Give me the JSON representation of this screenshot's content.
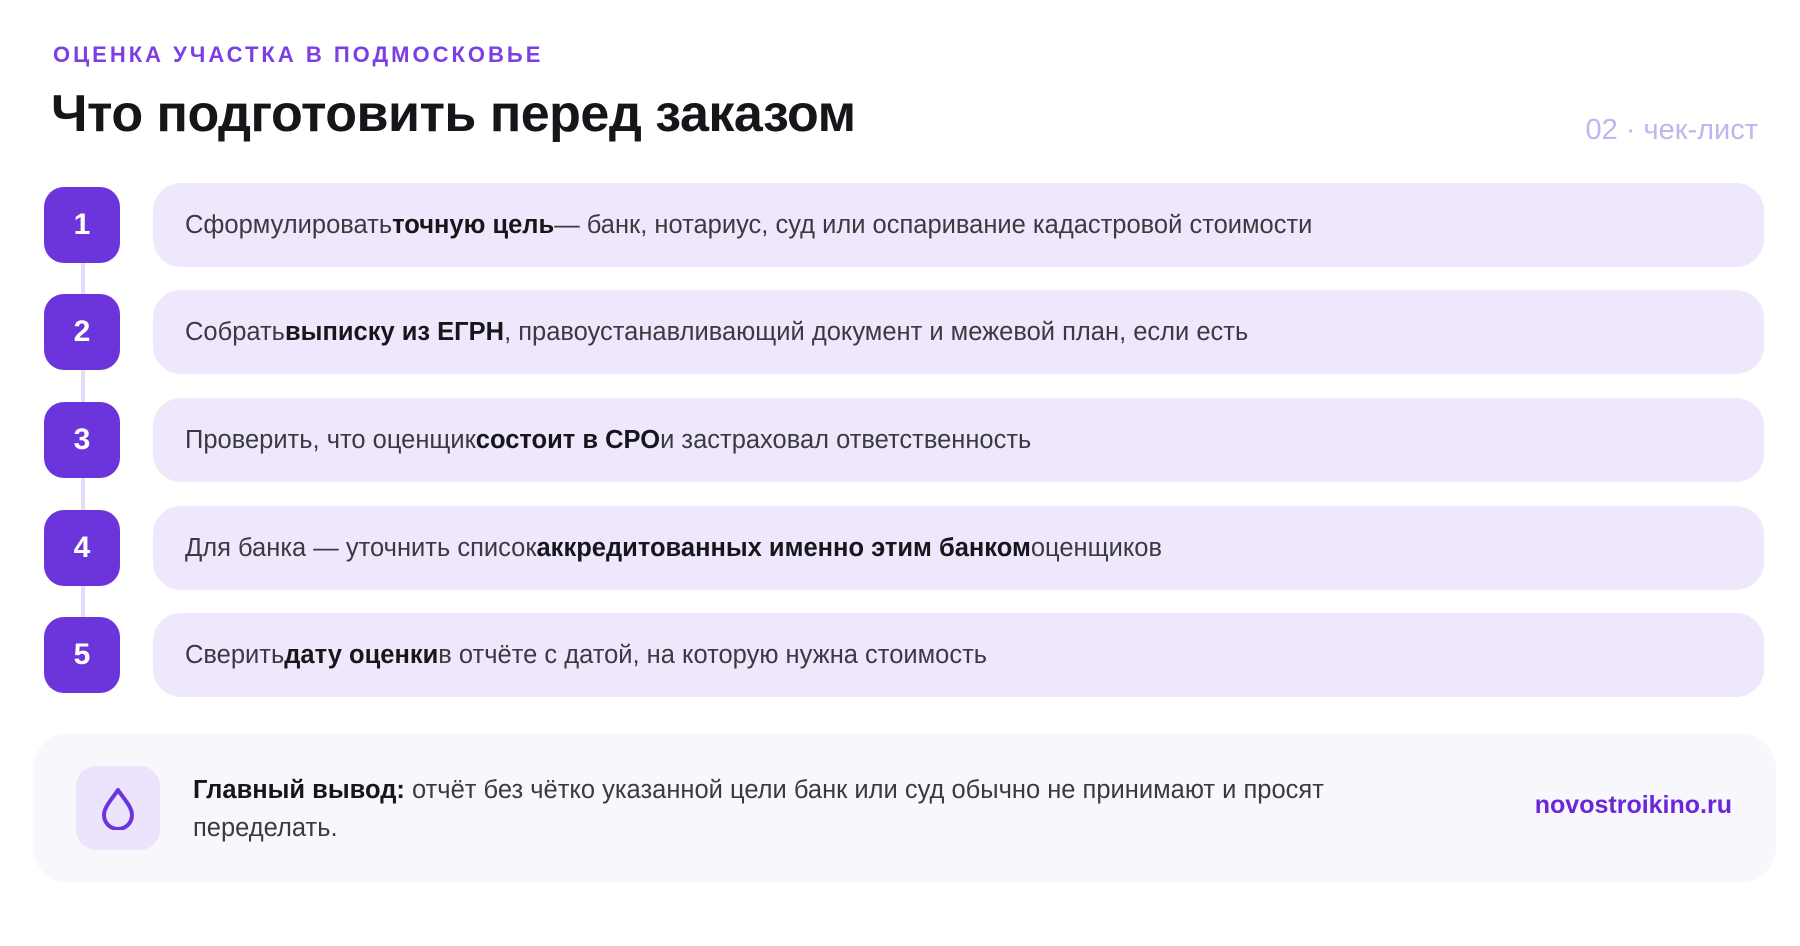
{
  "header": {
    "eyebrow": "ОЦЕНКА УЧАСТКА В ПОДМОСКОВЬЕ",
    "title": "Что подготовить перед заказом",
    "tag": "02 · чек-лист"
  },
  "steps": [
    {
      "number": "1",
      "before": "Сформулировать ",
      "bold": "точную цель",
      "after": " — банк, нотариус, суд или оспаривание кадастровой стоимости"
    },
    {
      "number": "2",
      "before": "Собрать ",
      "bold": "выписку из ЕГРН",
      "after": ", правоустанавливающий документ и межевой план, если есть"
    },
    {
      "number": "3",
      "before": "Проверить, что оценщик ",
      "bold": "состоит в СРО",
      "after": " и застраховал ответственность"
    },
    {
      "number": "4",
      "before": "Для банка — уточнить список ",
      "bold": "аккредитованных именно этим банком",
      "after": " оценщиков"
    },
    {
      "number": "5",
      "before": "Сверить ",
      "bold": "дату оценки",
      "after": " в отчёте с датой, на которую нужна стоимость"
    }
  ],
  "summary": {
    "icon": "drop-icon",
    "label": "Главный вывод:",
    "text": " отчёт без чётко указанной цели банк или суд обычно не принимают и просят переделать.",
    "brand": "novostroikino.ru"
  },
  "colors": {
    "accent": "#6c35dc",
    "pill_bg": "#efe8fd",
    "eyebrow": "#7b3fe4",
    "tag": "#c4b3ee"
  }
}
